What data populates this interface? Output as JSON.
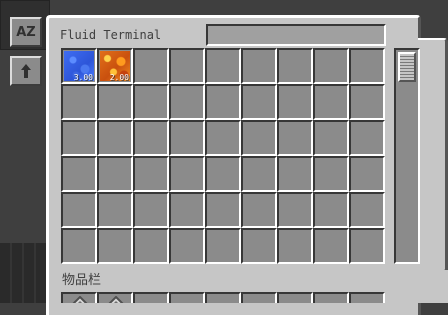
{
  "window": {
    "title": "Fluid Terminal",
    "search_value": ""
  },
  "sort_buttons": [
    {
      "label": "AZ",
      "icon": "sort-alpha-icon"
    },
    {
      "label": "",
      "icon": "arrow-up-icon"
    }
  ],
  "fluids": [
    {
      "name": "water",
      "amount": "3.00",
      "color": "#3f6df2"
    },
    {
      "name": "lava",
      "amount": "2.00",
      "color": "#e2701a"
    }
  ],
  "grid": {
    "columns": 9,
    "rows": 6
  },
  "inventory": {
    "label": "物品栏",
    "visible_items": [
      "pattern-icon",
      "pattern-icon"
    ]
  }
}
